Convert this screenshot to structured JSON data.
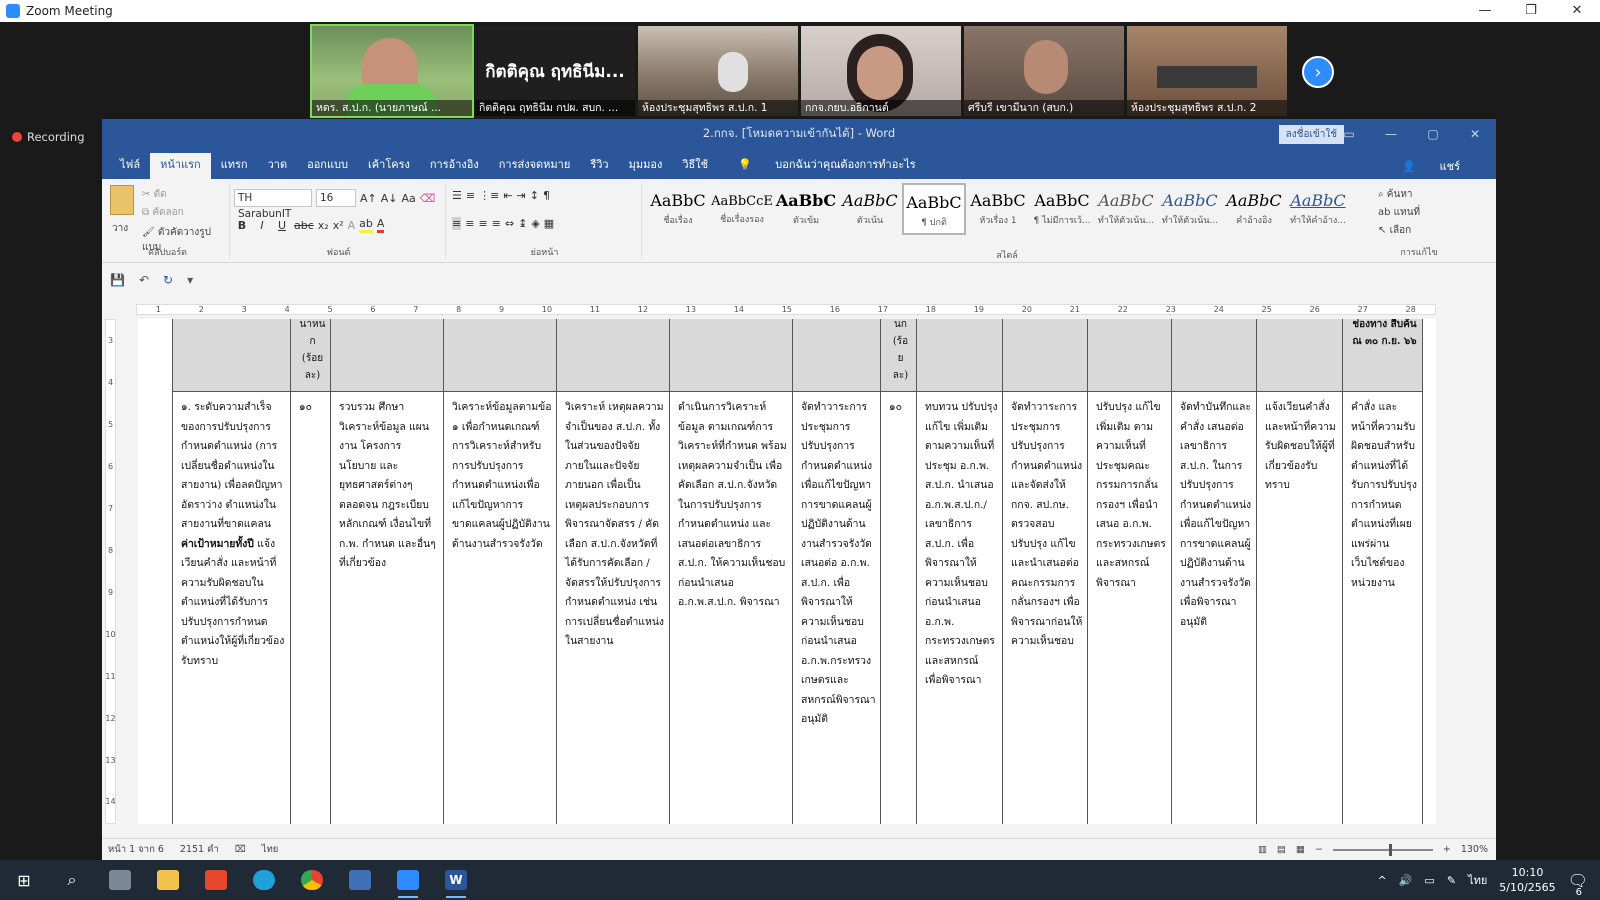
{
  "zoom": {
    "title": "Zoom Meeting",
    "recording_label": "Recording",
    "participants": [
      {
        "name": "หดร. ส.ป.ก. (นายภาษณ์ ...",
        "active": true,
        "bg": "#6b8e5a"
      },
      {
        "name": "กิตติคุณ ฤทธินีม กปผ. สบก. ...",
        "big": "กิตติคุณ ฤทธินีม...",
        "bg": "#1f1f1f"
      },
      {
        "name": "ห้องประชุมสุทธิพร ส.ป.ก. 1",
        "bg": "#8a7a6a"
      },
      {
        "name": "กกจ.กยบ.อธิกานต์",
        "bg": "#b5a9a6"
      },
      {
        "name": "ศรีบรี เขามีนาก (สบก.)",
        "bg": "#6a5a52"
      },
      {
        "name": "ห้องประชุมสุทธิพร ส.ป.ก. 2",
        "bg": "#7a5f4c"
      }
    ]
  },
  "word": {
    "title": "2.กกจ. [โหมดความเข้ากันได้] - Word",
    "signin_label": "ลงชื่อเข้าใช้",
    "tabs": [
      "ไฟล์",
      "หน้าแรก",
      "แทรก",
      "วาด",
      "ออกแบบ",
      "เค้าโครง",
      "การอ้างอิง",
      "การส่งจดหมาย",
      "รีวิว",
      "มุมมอง",
      "วิธีใช้"
    ],
    "tell_me": "บอกฉันว่าคุณต้องการทำอะไร",
    "share_label": "แชร์",
    "clipboard": {
      "paste": "วาง",
      "cut": "ตัด",
      "copy": "คัดลอก",
      "format_painter": "ตัวคัดวางรูปแบบ",
      "group": "คลิปบอร์ด"
    },
    "font": {
      "name": "TH SarabunIT",
      "size": "16",
      "group": "ฟอนต์"
    },
    "paragraph_group": "ย่อหน้า",
    "styles_group": "สไตล์",
    "styles": [
      {
        "preview": "AaBbC",
        "label": "ชื่อเรื่อง",
        "kind": "plain"
      },
      {
        "preview": "AaBbCcE",
        "label": "ชื่อเรื่องรอง",
        "kind": "plain"
      },
      {
        "preview": "AaBbC",
        "label": "ตัวเข้ม",
        "kind": "bold"
      },
      {
        "preview": "AaBbC",
        "label": "ตัวเน้น",
        "kind": "ital"
      },
      {
        "preview": "AaBbC",
        "label": "¶ ปกติ",
        "kind": "sel"
      },
      {
        "preview": "AaBbC",
        "label": "หัวเรื่อง 1",
        "kind": "plain"
      },
      {
        "preview": "AaBbC",
        "label": "¶ ไม่มีการเว้...",
        "kind": "plain"
      },
      {
        "preview": "AaBbC",
        "label": "ทำให้ตัวเน้น...",
        "kind": "ital"
      },
      {
        "preview": "AaBbC",
        "label": "ทำให้ตัวเน้น...",
        "kind": "blue"
      },
      {
        "preview": "AaBbC",
        "label": "คำอ้างอิง",
        "kind": "ital"
      },
      {
        "preview": "AaBbC",
        "label": "ทำให้คำอ้าง...",
        "kind": "blue"
      }
    ],
    "editing": {
      "find": "ค้นหา",
      "replace": "แทนที่",
      "select": "เลือก",
      "group": "การแก้ไข"
    },
    "ruler_marks": [
      "1",
      "2",
      "3",
      "4",
      "5",
      "6",
      "7",
      "8",
      "9",
      "10",
      "11",
      "12",
      "13",
      "14",
      "15",
      "16",
      "17",
      "18",
      "19",
      "20",
      "21",
      "22",
      "23",
      "24",
      "25",
      "26",
      "27",
      "28"
    ],
    "vruler_marks": [
      "3",
      "4",
      "5",
      "6",
      "7",
      "8",
      "9",
      "10",
      "11",
      "12",
      "13",
      "14"
    ],
    "table": {
      "header_cells": [
        "",
        "นาหน ก (ร้อย ละ)",
        "",
        "",
        "",
        "",
        "",
        "นก (ร้อ ย ละ)",
        "",
        "",
        "",
        "",
        "",
        "ช่องทาง สืบค้น ณ ๓๐ ก.ย. ๖๖"
      ],
      "body_cells": [
        {
          "text": "๑. ระดับความสำเร็จของการปรับปรุงการกำหนดตำแหน่ง (การเปลี่ยนชื่อตำแหน่งในสายงาน) เพื่อลดปัญหาอัตราว่าง ตำแหน่งในสายงานที่ขาดแคลน",
          "bold": "ค่าเป้าหมายทั้งปี",
          "rest": "แจ้งเวียนคำสั่ง และหน้าที่ความรับผิดชอบในตำแหน่งที่ได้รับการปรับปรุงการกำหนดตำแหน่งให้ผู้ที่เกี่ยวข้องรับทราบ"
        },
        {
          "text": "๑๐"
        },
        {
          "text": "รวบรวม ศึกษา วิเคราะห์ข้อมูล แผนงาน โครงการ นโยบาย และยุทธศาสตร์ต่างๆ ตลอดจน กฎระเบียบ หลักเกณฑ์ เงื่อนไขที่ ก.พ. กำหนด และอื่นๆ ที่เกี่ยวข้อง"
        },
        {
          "text": "วิเคราะห์ข้อมูลตามข้อ ๑ เพื่อกำหนดเกณฑ์การวิเคราะห์สำหรับการปรับปรุงการกำหนดตำแหน่งเพื่อแก้ไขปัญหาการขาดแคลนผู้ปฏิบัติงานด้านงานสำรวจรังวัด"
        },
        {
          "text": "วิเคราะห์ เหตุผลความจำเป็นของ ส.ป.ก. ทั้งในส่วนของปัจจัยภายในและปัจจัยภายนอก เพื่อเป็นเหตุผลประกอบการพิจารณาจัดสรร / คัดเลือก ส.ป.ก.จังหวัดที่ได้รับการคัดเลือก /จัดสรรให้ปรับปรุงการกำหนดตำแหน่ง เช่น การเปลี่ยนชื่อตำแหน่งในสายงาน"
        },
        {
          "text": "ดำเนินการวิเคราะห์ข้อมูล ตามเกณฑ์การวิเคราะห์ที่กำหนด พร้อมเหตุผลความจำเป็น เพื่อคัดเลือก ส.ป.ก.จังหวัด ในการปรับปรุงการกำหนดตำแหน่ง และเสนอต่อเลขาธิการ ส.ป.ก. ให้ความเห็นชอบ ก่อนนำเสนอ อ.ก.พ.ส.ป.ก. พิจารณา"
        },
        {
          "text": "จัดทำวาระการประชุมการปรับปรุงการกำหนดตำแหน่งเพื่อแก้ไขปัญหาการขาดแคลนผู้ปฏิบัติงานด้านงานสำรวจรังวัด เสนอต่อ อ.ก.พ. ส.ป.ก. เพื่อพิจารณาให้ความเห็นชอบก่อนนำเสนอ อ.ก.พ.กระทรวงเกษตรและสหกรณ์พิจารณาอนุมัติ"
        },
        {
          "text": "๑๐"
        },
        {
          "text": "ทบทวน ปรับปรุง แก้ไข เพิ่มเติม ตามความเห็นที่ประชุม อ.ก.พ. ส.ป.ก. นำเสนอ อ.ก.พ.ส.ป.ก./เลขาธิการ ส.ป.ก. เพื่อพิจารณาให้ความเห็นชอบก่อนนำเสนอ อ.ก.พ. กระทรวงเกษตรและสหกรณ์ เพื่อพิจารณา"
        },
        {
          "text": "จัดทำวาระการประชุมการปรับปรุงการกำหนดตำแหน่ง และจัดส่งให้ กกจ. สป.กษ. ตรวจสอบ ปรับปรุง แก้ไข และนำเสนอต่อคณะกรรมการกลั่นกรองฯ เพื่อพิจารณาก่อนให้ความเห็นชอบ"
        },
        {
          "text": "ปรับปรุง แก้ไข เพิ่มเติม ตามความเห็นที่ประชุมคณะกรรมการกลั่นกรองฯ เพื่อนำเสนอ อ.ก.พ. กระทรวงเกษตรและสหกรณ์ พิจารณา"
        },
        {
          "text": "จัดทำบันทึกและคำสั่ง เสนอต่อเลขาธิการ ส.ป.ก. ในการปรับปรุงการกำหนดตำแหน่ง เพื่อแก้ไขปัญหาการขาดแคลนผู้ปฏิบัติงานด้านงานสำรวจรังวัด เพื่อพิจารณาอนุมัติ"
        },
        {
          "text": "แจ้งเวียนคำสั่ง และหน้าที่ความรับผิดชอบให้ผู้ที่เกี่ยวข้องรับทราบ"
        },
        {
          "text": "คำสั่ง และหน้าที่ความรับผิดชอบสำหรับตำแหน่งที่ได้รับการปรับปรุงการกำหนดตำแหน่งที่เผยแพร่ผ่านเว็บไซต์ของหน่วยงาน"
        }
      ]
    },
    "status": {
      "page": "หน้า 1 จาก 6",
      "words": "2151 คำ",
      "lang": "ไทย",
      "zoom": "130%"
    }
  },
  "taskbar": {
    "time": "10:10",
    "date": "5/10/2565",
    "lang": "ไทย",
    "notif_count": "6"
  }
}
